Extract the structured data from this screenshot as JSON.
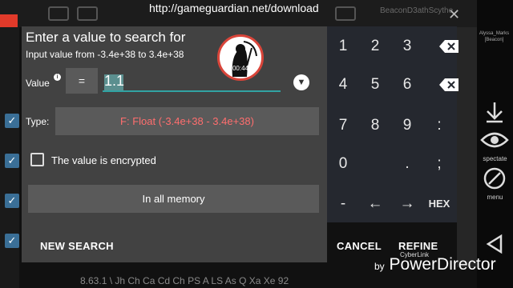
{
  "url_overlay": "http://gameguardian.net/download",
  "background": {
    "title": "BeaconD3athScythe",
    "bottom_text": "8.63.1 \\ Jh Ch Ca Cd Ch PS A LS As Q Xa Xe 92",
    "close_icon": "✕"
  },
  "dialog": {
    "title": "Enter a value to search for",
    "subtitle": "Input value from -3.4e+38 to 3.4e+38",
    "avatar_time": "00:44",
    "value_label": "Value",
    "info_icon": "i",
    "operator": "=",
    "value": "1.1",
    "dropdown_icon": "▼",
    "type_label": "Type:",
    "type_value": "F: Float (-3.4e+38 - 3.4e+38)",
    "encrypted_label": "The value is encrypted",
    "memory_range": "In all memory",
    "new_search": "NEW SEARCH",
    "cancel": "CANCEL",
    "refine": "REFINE"
  },
  "keypad": {
    "rows": [
      [
        "1",
        "2",
        "3",
        "⌫"
      ],
      [
        "4",
        "5",
        "6",
        "⌫"
      ],
      [
        "7",
        "8",
        "9",
        ":"
      ],
      [
        "0",
        "",
        ".",
        ";"
      ],
      [
        "-",
        "←",
        "→",
        "HEX"
      ]
    ]
  },
  "navbar": {
    "mini_user": "Alyssa_Marks",
    "mini_label": "[Beacon]",
    "spectate_label": "spectate",
    "menu_label": "menu"
  },
  "watermark": {
    "cyberlink": "CyberLink",
    "by": "by",
    "powerdirector": "PowerDirector"
  },
  "colors": {
    "dialog_bg": "#424242",
    "keypad_bg": "#25282f",
    "type_text": "#ff6e6e",
    "input_underline": "#31a3a3",
    "accent_red": "#d9453a"
  }
}
